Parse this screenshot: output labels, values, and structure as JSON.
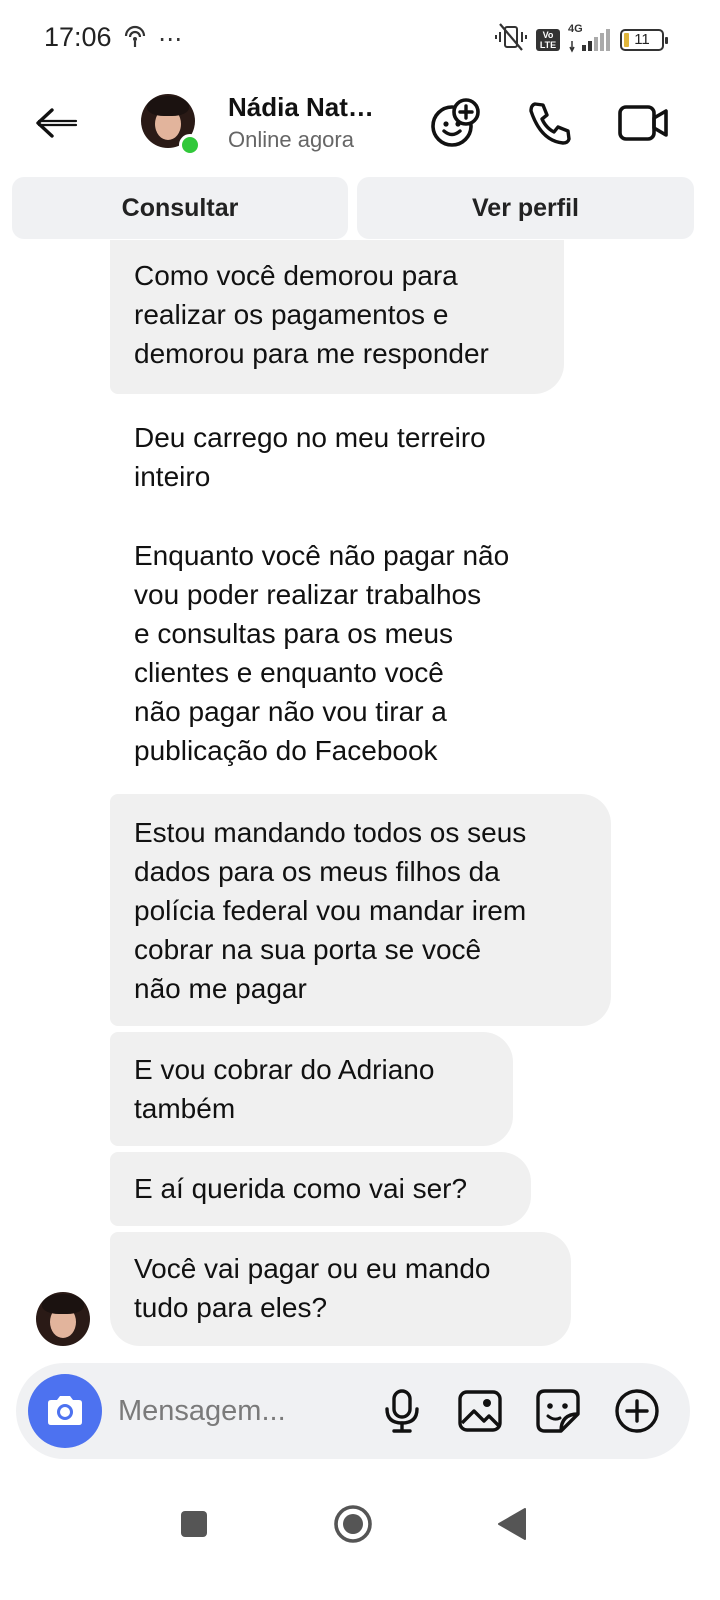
{
  "status_bar": {
    "time": "17:06",
    "more": "⋯",
    "network": "4G",
    "volte": "Vo LTE",
    "battery": "11"
  },
  "header": {
    "contact_name": "Nádia Nat…",
    "contact_status": "Online agora"
  },
  "actions": {
    "consult_label": "Consultar",
    "profile_label": "Ver perfil"
  },
  "messages": [
    {
      "style": "bubble",
      "lines": [
        "Como você demorou para",
        "realizar os pagamentos e",
        "demorou para me responder"
      ]
    },
    {
      "style": "plain",
      "lines": [
        "Deu carrego no meu terreiro",
        "inteiro"
      ]
    },
    {
      "style": "plain",
      "lines": [
        "Enquanto você não pagar não",
        "vou poder realizar trabalhos",
        "e consultas para os meus",
        "clientes e enquanto você",
        "não pagar não vou tirar a",
        "publicação do Facebook"
      ]
    },
    {
      "style": "bubble",
      "lines": [
        "Estou mandando todos os seus",
        "dados para os meus filhos da",
        "polícia federal vou mandar irem",
        "cobrar na sua porta se você",
        "não me pagar"
      ]
    },
    {
      "style": "bubble",
      "lines": [
        "E vou cobrar do Adriano",
        "também"
      ]
    },
    {
      "style": "bubble",
      "lines": [
        "E aí querida como vai ser?"
      ]
    },
    {
      "style": "bubble",
      "lines": [
        "Você vai pagar ou eu mando",
        "tudo para eles?"
      ]
    }
  ],
  "composer": {
    "placeholder": "Mensagem..."
  },
  "colors": {
    "accent": "#4d72f0",
    "online": "#31c83a",
    "bubble": "#f0f0f0",
    "button_bg": "#f0f1f3"
  }
}
